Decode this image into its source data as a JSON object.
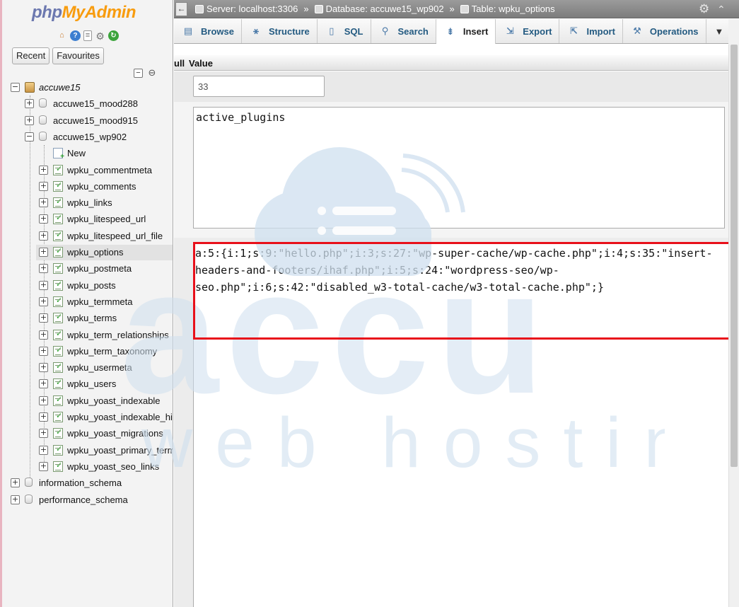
{
  "nav": {
    "logo_php": "php",
    "logo_admin": "MyAdmin",
    "recent_label": "Recent",
    "favourites_label": "Favourites",
    "tree": [
      {
        "label": "accuwe15",
        "level": 0,
        "type": "server",
        "expanded": true
      },
      {
        "label": "accuwe15_mood288",
        "level": 1,
        "type": "db",
        "expanded": false
      },
      {
        "label": "accuwe15_mood915",
        "level": 1,
        "type": "db",
        "expanded": false
      },
      {
        "label": "accuwe15_wp902",
        "level": 1,
        "type": "db",
        "expanded": true
      },
      {
        "label": "New",
        "level": 2,
        "type": "new"
      },
      {
        "label": "wpku_commentmeta",
        "level": 2,
        "type": "table"
      },
      {
        "label": "wpku_comments",
        "level": 2,
        "type": "table"
      },
      {
        "label": "wpku_links",
        "level": 2,
        "type": "table"
      },
      {
        "label": "wpku_litespeed_url",
        "level": 2,
        "type": "table"
      },
      {
        "label": "wpku_litespeed_url_file",
        "level": 2,
        "type": "table"
      },
      {
        "label": "wpku_options",
        "level": 2,
        "type": "table",
        "selected": true
      },
      {
        "label": "wpku_postmeta",
        "level": 2,
        "type": "table"
      },
      {
        "label": "wpku_posts",
        "level": 2,
        "type": "table"
      },
      {
        "label": "wpku_termmeta",
        "level": 2,
        "type": "table"
      },
      {
        "label": "wpku_terms",
        "level": 2,
        "type": "table"
      },
      {
        "label": "wpku_term_relationships",
        "level": 2,
        "type": "table"
      },
      {
        "label": "wpku_term_taxonomy",
        "level": 2,
        "type": "table"
      },
      {
        "label": "wpku_usermeta",
        "level": 2,
        "type": "table"
      },
      {
        "label": "wpku_users",
        "level": 2,
        "type": "table"
      },
      {
        "label": "wpku_yoast_indexable",
        "level": 2,
        "type": "table"
      },
      {
        "label": "wpku_yoast_indexable_hierarchy",
        "level": 2,
        "type": "table"
      },
      {
        "label": "wpku_yoast_migrations",
        "level": 2,
        "type": "table"
      },
      {
        "label": "wpku_yoast_primary_term",
        "level": 2,
        "type": "table"
      },
      {
        "label": "wpku_yoast_seo_links",
        "level": 2,
        "type": "table"
      },
      {
        "label": "information_schema",
        "level": 0,
        "type": "db",
        "expanded": false
      },
      {
        "label": "performance_schema",
        "level": 0,
        "type": "db",
        "expanded": false
      }
    ]
  },
  "topbar": {
    "back": "←",
    "server": "Server: localhost:3306",
    "database": "Database: accuwe15_wp902",
    "table": "Table: wpku_options",
    "separator": "»"
  },
  "tabs": [
    {
      "label": "Browse",
      "icon": "browse-icon",
      "glyph": "▤"
    },
    {
      "label": "Structure",
      "icon": "structure-icon",
      "glyph": "⚹"
    },
    {
      "label": "SQL",
      "icon": "sql-icon",
      "glyph": "▯"
    },
    {
      "label": "Search",
      "icon": "search-icon",
      "glyph": "⚲"
    },
    {
      "label": "Insert",
      "icon": "insert-icon",
      "glyph": "⇟",
      "active": true
    },
    {
      "label": "Export",
      "icon": "export-icon",
      "glyph": "⇲"
    },
    {
      "label": "Import",
      "icon": "import-icon",
      "glyph": "⇱"
    },
    {
      "label": "Operations",
      "icon": "operations-icon",
      "glyph": "⚒"
    }
  ],
  "table_header": {
    "null_label": "ull",
    "value_label": "Value"
  },
  "form": {
    "option_id": "33",
    "option_name": "active_plugins",
    "option_value_lines": [
      "a:5:{i:1;s:9:\"hello.php\";i:3;s:27:\"wp-super-cache/wp-cache.php\";i:4;s:35:\"insert-",
      "headers-and-footers/ihaf.php\";i:5;s:24:\"wordpress-seo/wp-",
      "seo.php\";i:6;s:42:\"disabled_w3-total-cache/w3-total-cache.php\";}"
    ]
  },
  "watermark": {
    "brand": "accu",
    "tagline": "web hosting"
  },
  "colors": {
    "highlight": "#e8101a",
    "tab_link": "#235a81",
    "logo_php": "#6c78af",
    "logo_admin": "#f89c0e"
  }
}
